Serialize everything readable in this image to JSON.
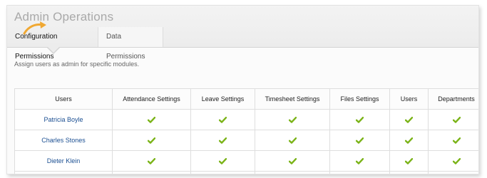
{
  "header": {
    "title": "Admin Operations",
    "tabs": [
      {
        "label": "Configuration Permissions",
        "active": true
      },
      {
        "label": "Data Permissions",
        "active": false
      }
    ]
  },
  "description": "Assign users as admin for specific modules.",
  "table": {
    "columns": [
      "Users",
      "Attendance Settings",
      "Leave Settings",
      "Timesheet Settings",
      "Files Settings",
      "Users",
      "Departments"
    ],
    "rows": [
      {
        "user": "Patricia Boyle",
        "permissions": [
          true,
          true,
          true,
          true,
          true,
          true
        ]
      },
      {
        "user": "Charles Stones",
        "permissions": [
          true,
          true,
          true,
          true,
          true,
          true
        ]
      },
      {
        "user": "Dieter Klein",
        "permissions": [
          true,
          true,
          true,
          true,
          true,
          true
        ]
      }
    ]
  },
  "colors": {
    "check": "#7ab317",
    "user_link": "#1b4f92",
    "arrow": "#f0a832"
  },
  "icons": {
    "check": "check-icon",
    "arrow": "curved-arrow-icon"
  }
}
